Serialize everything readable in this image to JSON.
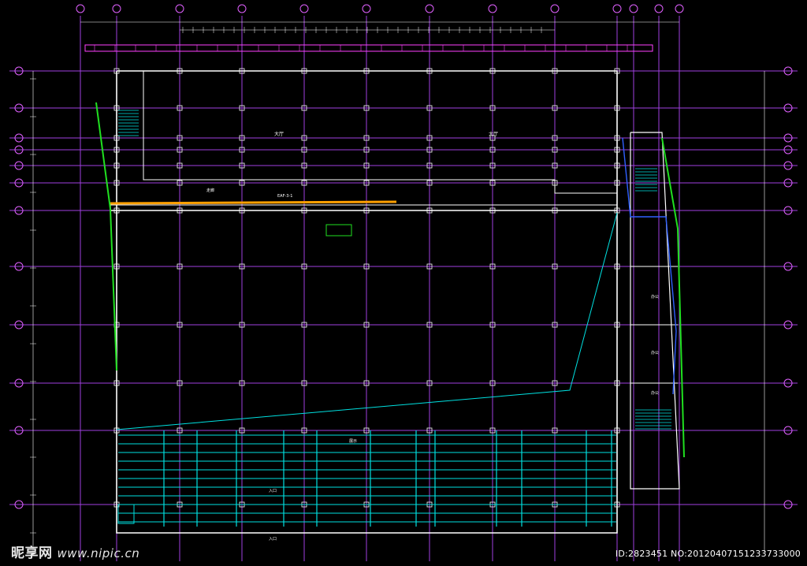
{
  "watermark": {
    "brand": "昵享网",
    "url": "www.nipic.cn"
  },
  "image_id_text": "ID:2823451 NO:20120407151233733000",
  "room_labels": [
    "大厅",
    "大厅",
    "走廊",
    "办公",
    "办公",
    "办公",
    "展示",
    "入口",
    "入口"
  ],
  "dim_text": [
    "EAF-3-1"
  ],
  "colors": {
    "background": "#000000",
    "grid": "#a040e0",
    "walls": "#ffffff",
    "stairs": "#00e0e0",
    "duct": "#ffa000",
    "green_line": "#20e020",
    "blue_line": "#3060ff",
    "magenta": "#ff40ff"
  }
}
